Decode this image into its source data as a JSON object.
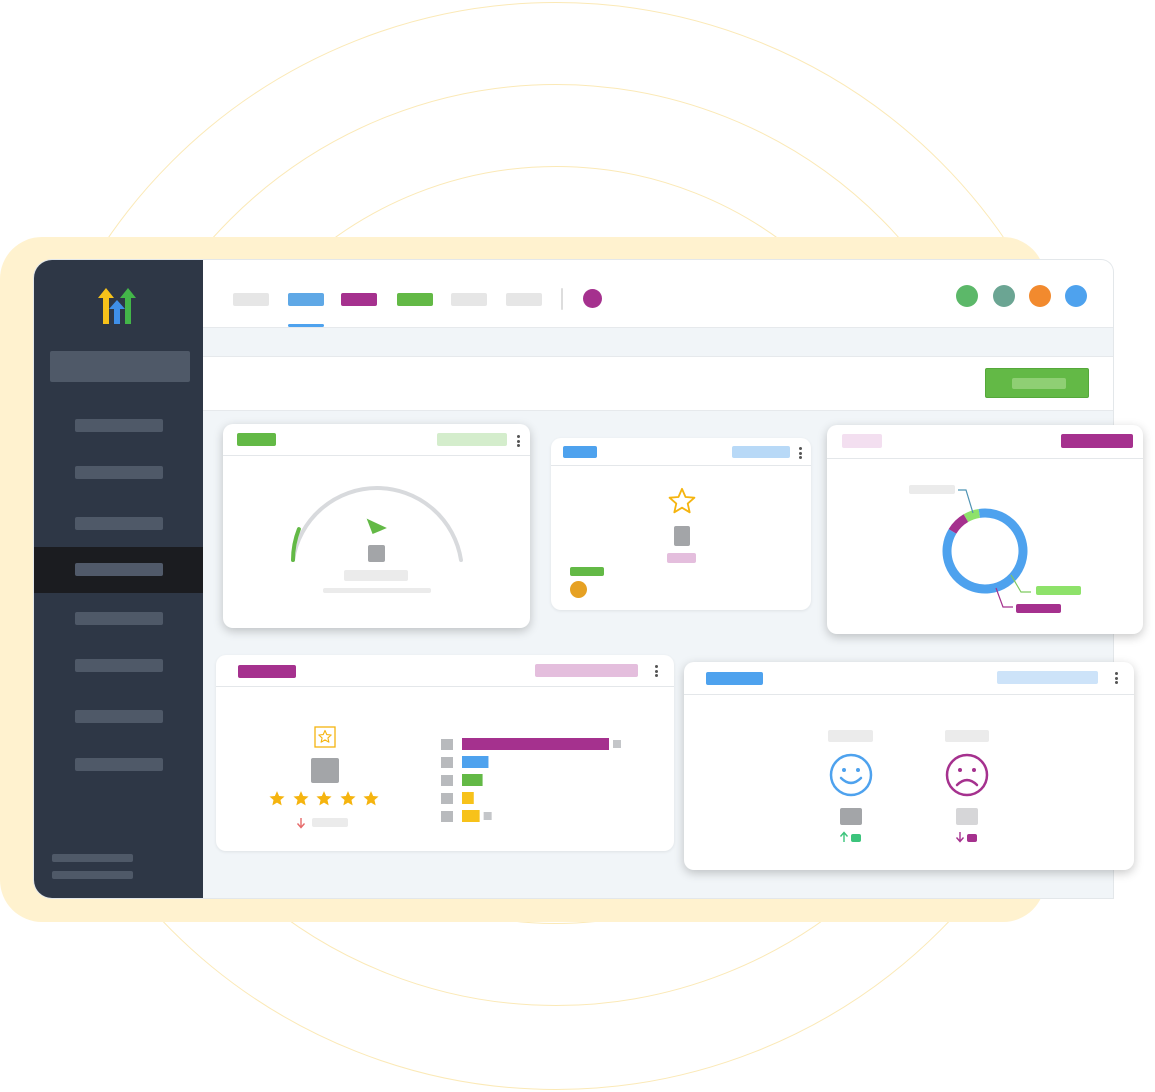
{
  "app": {
    "logo": "gohighlevel-logo"
  },
  "colors": {
    "sidebar": "#2e3746",
    "green": "#63b946",
    "blue": "#4ea2ee",
    "purple": "#a5318e",
    "orange": "#f28a2e",
    "teal": "#6ba593",
    "yellow": "#f7c21a"
  },
  "sidebar": {
    "items": [
      {
        "id": "nav-1",
        "active": false
      },
      {
        "id": "nav-2",
        "active": false
      },
      {
        "id": "nav-3",
        "active": false
      },
      {
        "id": "nav-4",
        "active": true
      },
      {
        "id": "nav-5",
        "active": false
      },
      {
        "id": "nav-6",
        "active": false
      },
      {
        "id": "nav-7",
        "active": false
      },
      {
        "id": "nav-8",
        "active": false
      }
    ]
  },
  "topbar": {
    "tabs": [
      "tab-gray",
      "tab-blue-active",
      "tab-purple",
      "tab-green",
      "tab-gray",
      "tab-gray"
    ],
    "status_dot": "purple-dot",
    "avatars": [
      "green-avatar",
      "teal-avatar",
      "orange-avatar",
      "blue-avatar"
    ]
  },
  "widgets": {
    "gauge": {
      "type": "gauge",
      "value_fraction": 0.12,
      "icons": [
        "pointer-icon"
      ]
    },
    "rating_small": {
      "icons": [
        "star-icon"
      ]
    },
    "donut": {
      "type": "pie",
      "segments": [
        {
          "color": "#4ea2ee",
          "value": 86
        },
        {
          "color": "#a5318e",
          "value": 8
        },
        {
          "color": "#8ee26a",
          "value": 6
        }
      ]
    },
    "reviews": {
      "stars": 5,
      "trend": "down",
      "bars": [
        {
          "color": "#a5318e",
          "value": 100
        },
        {
          "color": "#4ea2ee",
          "value": 18
        },
        {
          "color": "#63b946",
          "value": 14
        },
        {
          "color": "#f7c21a",
          "value": 8
        },
        {
          "color": "#f7c21a",
          "value": 12
        }
      ]
    },
    "sentiment": {
      "positive": {
        "icon": "smile-icon",
        "trend": "up"
      },
      "negative": {
        "icon": "frown-icon",
        "trend": "down"
      }
    }
  }
}
